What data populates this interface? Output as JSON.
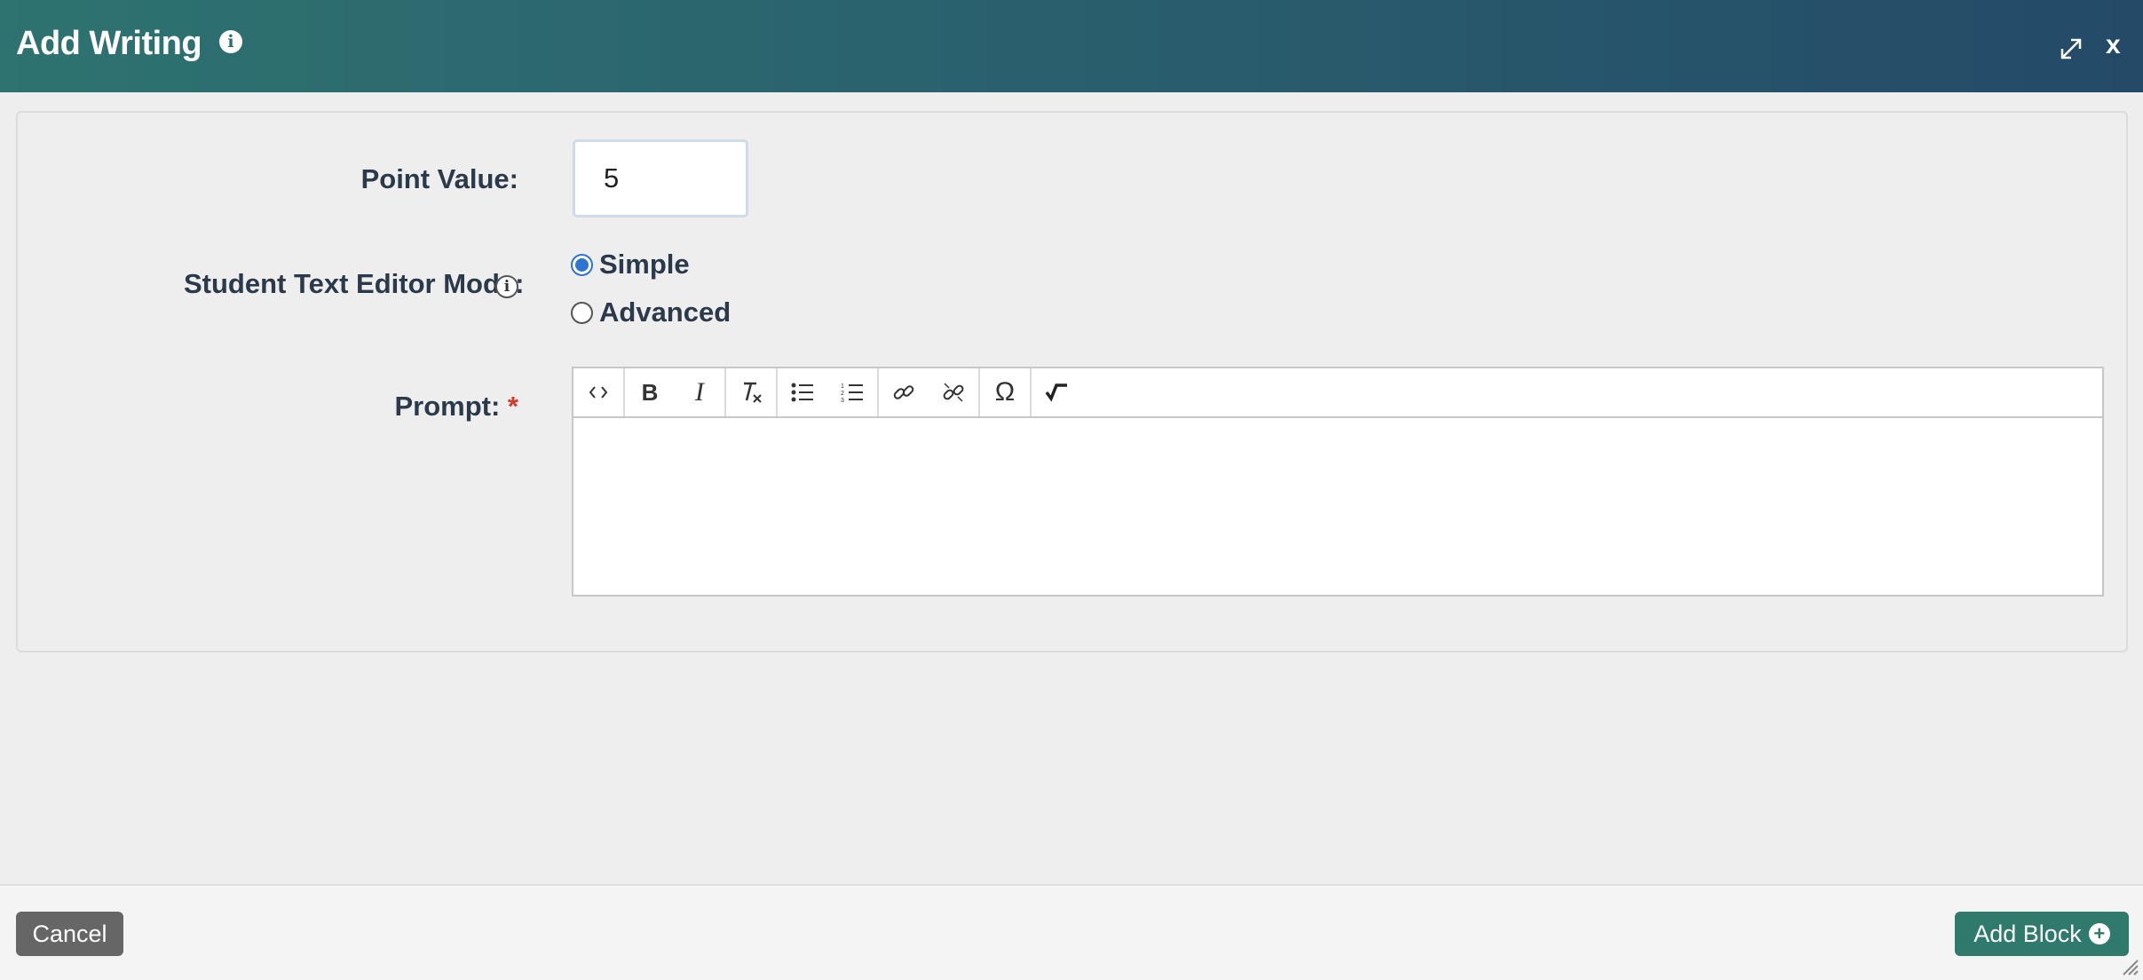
{
  "dialog": {
    "title": "Add Writing",
    "close_label": "x"
  },
  "form": {
    "point_value_label": "Point Value:",
    "point_value": "5",
    "editor_mode_label": "Student Text Editor Mode:",
    "editor_mode_options": [
      {
        "label": "Simple",
        "selected": true
      },
      {
        "label": "Advanced",
        "selected": false
      }
    ],
    "prompt_label": "Prompt:",
    "prompt_required_mark": "*"
  },
  "toolbar": {
    "buttons": [
      "source-code",
      "bold",
      "italic",
      "remove-format",
      "bulleted-list",
      "numbered-list",
      "link",
      "unlink",
      "special-character",
      "math-equation"
    ],
    "bold_glyph": "B",
    "italic_glyph": "I",
    "omega_glyph": "Ω"
  },
  "footer": {
    "cancel_label": "Cancel",
    "add_block_label": "Add Block"
  },
  "colors": {
    "header_start": "#2e7370",
    "header_end": "#244a68",
    "primary_button": "#2f7a6c",
    "cancel_button": "#666666",
    "radio_selected": "#2f74d0",
    "required": "#d43a2a"
  }
}
